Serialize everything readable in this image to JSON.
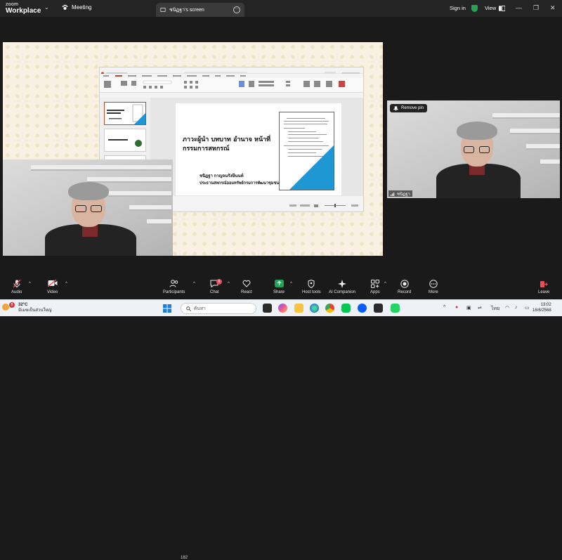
{
  "titlebar": {
    "brand_top": "zoom",
    "brand_bottom": "Workplace",
    "meeting_label": "Meeting",
    "tab_label": "ชนิฏฐา's screen",
    "signin_label": "Sign in",
    "view_label": "View"
  },
  "share": {
    "slide_title": "ภาวะผู้นำ บทบาท อำนาจ หน้าที่ กรรมการสหกรณ์",
    "presenter_name": "ชนิฏฐา  กาญจนรังษีนนท์",
    "presenter_role": "ประธานสหกรณ์ออมทรัพย์กรมการพัฒนาชุมชน จำกัด"
  },
  "tile2": {
    "remove_pin_label": "Remove pin",
    "name": "ชนิฏฐา"
  },
  "toolbar": {
    "audio": "Audio",
    "video": "Video",
    "participants": "Participants",
    "participants_count": "182",
    "chat": "Chat",
    "chat_badge": "6",
    "react": "React",
    "share": "Share",
    "host_tools": "Host tools",
    "ai_companion": "AI Companion",
    "apps": "Apps",
    "record": "Record",
    "more": "More",
    "leave": "Leave"
  },
  "taskbar": {
    "weather_badge": "8",
    "temperature": "32°C",
    "weather_desc": "มีเมฆเป็นส่วนใหญ่",
    "search_placeholder": "ค้นหา",
    "language": "ไทย",
    "time": "13:02",
    "date": "16/6/2568"
  },
  "colors": {
    "accent_blue": "#1e97d4",
    "ppt_red": "#b7472a",
    "leave_red": "#e8505b",
    "share_green": "#23a455"
  }
}
